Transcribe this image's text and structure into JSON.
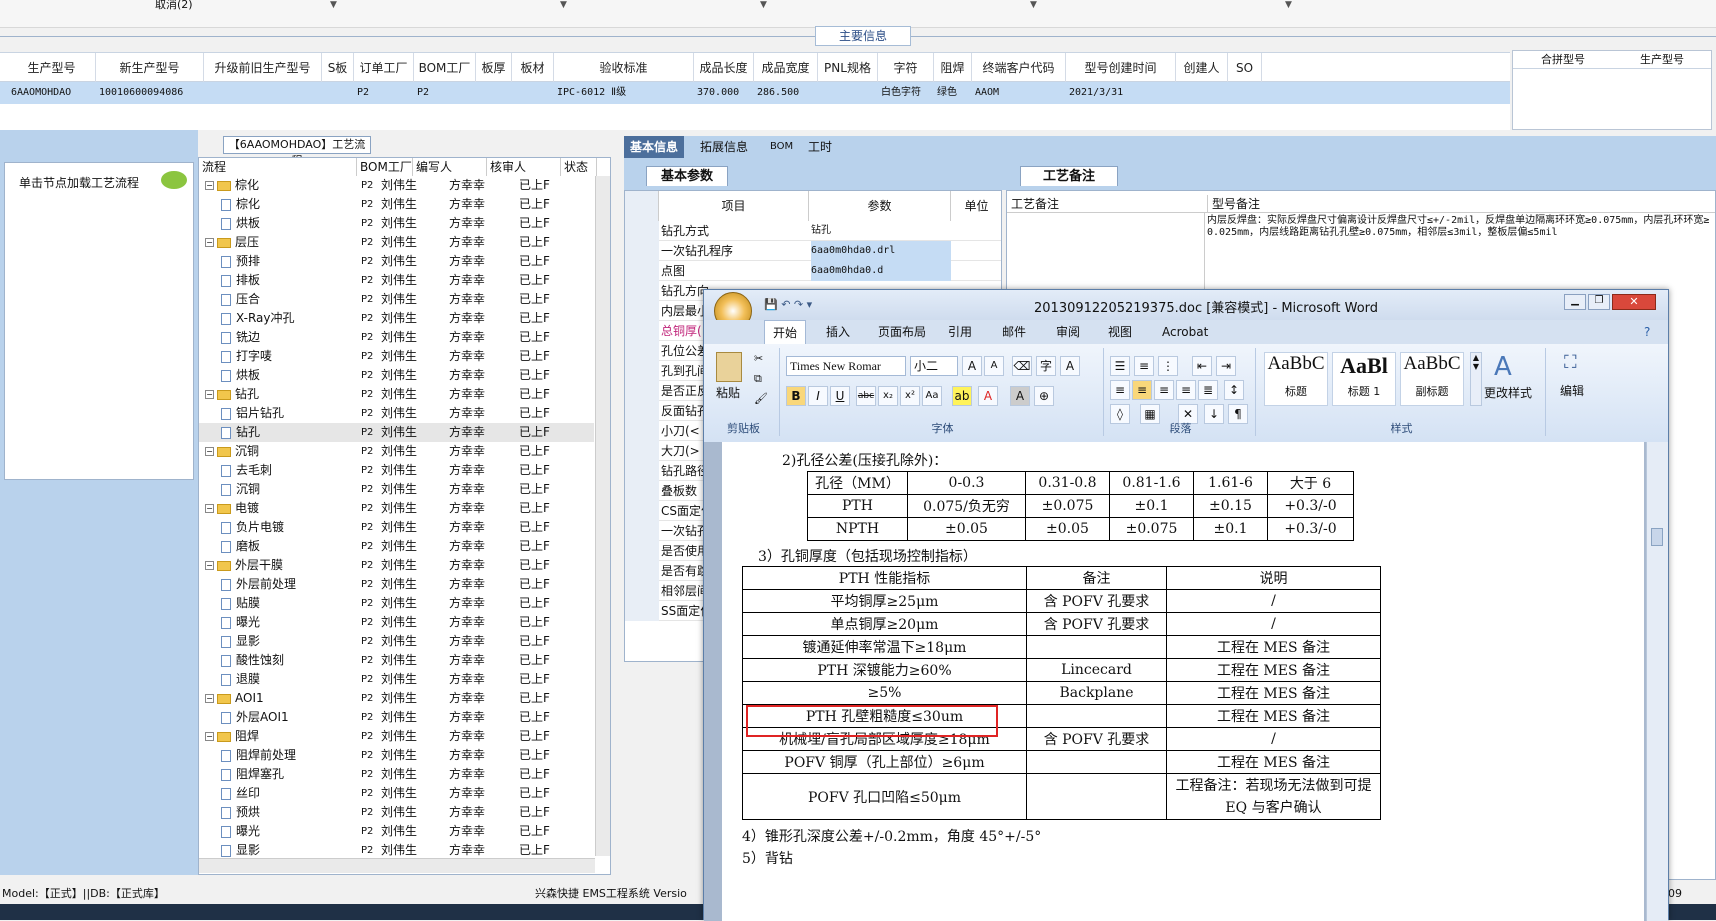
{
  "top": {
    "cancel_label": "取消(2)",
    "main_info_label": "主要信息"
  },
  "info_table": {
    "headers": [
      "生产型号",
      "新生产型号",
      "升级前旧生产型号",
      "S板",
      "订单工厂",
      "BOM工厂",
      "板厚",
      "板材",
      "验收标准",
      "成品长度",
      "成品宽度",
      "PNL规格",
      "字符",
      "阻焊",
      "终端客户代码",
      "型号创建时间",
      "创建人",
      "SO"
    ],
    "row": [
      "6AAOMOHDAO",
      "10010600094086",
      "",
      "",
      "P2",
      "P2",
      "",
      "",
      "IPC-6012 Ⅱ级",
      "370.000",
      "286.500",
      "",
      "白色字符",
      "绿色",
      "AAOM",
      "2021/3/31",
      "",
      ""
    ],
    "right_headers": [
      "合拼型号",
      "生产型号"
    ]
  },
  "left_panel": {
    "title": "单击节点加载工艺流程"
  },
  "process": {
    "title": "【6AAOMOHDAO】工艺流程",
    "headers": [
      "流程",
      "BOM工厂",
      "编写人",
      "核审人",
      "状态"
    ],
    "rows": [
      {
        "name": "棕化",
        "type": "group",
        "factory": "P2",
        "writer": "刘伟生",
        "reviewer": "方幸幸",
        "status": "已上F"
      },
      {
        "name": "棕化",
        "type": "item",
        "factory": "P2",
        "writer": "刘伟生",
        "reviewer": "方幸幸",
        "status": "已上F"
      },
      {
        "name": "烘板",
        "type": "item",
        "factory": "P2",
        "writer": "刘伟生",
        "reviewer": "方幸幸",
        "status": "已上F"
      },
      {
        "name": "层压",
        "type": "group",
        "factory": "P2",
        "writer": "刘伟生",
        "reviewer": "方幸幸",
        "status": "已上F"
      },
      {
        "name": "预排",
        "type": "item",
        "factory": "P2",
        "writer": "刘伟生",
        "reviewer": "方幸幸",
        "status": "已上F"
      },
      {
        "name": "排板",
        "type": "item",
        "factory": "P2",
        "writer": "刘伟生",
        "reviewer": "方幸幸",
        "status": "已上F"
      },
      {
        "name": "压合",
        "type": "item",
        "factory": "P2",
        "writer": "刘伟生",
        "reviewer": "方幸幸",
        "status": "已上F"
      },
      {
        "name": "X-Ray冲孔",
        "type": "item",
        "factory": "P2",
        "writer": "刘伟生",
        "reviewer": "方幸幸",
        "status": "已上F"
      },
      {
        "name": "铣边",
        "type": "item",
        "factory": "P2",
        "writer": "刘伟生",
        "reviewer": "方幸幸",
        "status": "已上F"
      },
      {
        "name": "打字唛",
        "type": "item",
        "factory": "P2",
        "writer": "刘伟生",
        "reviewer": "方幸幸",
        "status": "已上F"
      },
      {
        "name": "烘板",
        "type": "item",
        "factory": "P2",
        "writer": "刘伟生",
        "reviewer": "方幸幸",
        "status": "已上F"
      },
      {
        "name": "钻孔",
        "type": "group",
        "factory": "P2",
        "writer": "刘伟生",
        "reviewer": "方幸幸",
        "status": "已上F"
      },
      {
        "name": "铝片钻孔",
        "type": "item",
        "factory": "P2",
        "writer": "刘伟生",
        "reviewer": "方幸幸",
        "status": "已上F"
      },
      {
        "name": "钻孔",
        "type": "item",
        "factory": "P2",
        "writer": "刘伟生",
        "reviewer": "方幸幸",
        "status": "已上F",
        "selected": true
      },
      {
        "name": "沉铜",
        "type": "group",
        "factory": "P2",
        "writer": "刘伟生",
        "reviewer": "方幸幸",
        "status": "已上F"
      },
      {
        "name": "去毛刺",
        "type": "item",
        "factory": "P2",
        "writer": "刘伟生",
        "reviewer": "方幸幸",
        "status": "已上F"
      },
      {
        "name": "沉铜",
        "type": "item",
        "factory": "P2",
        "writer": "刘伟生",
        "reviewer": "方幸幸",
        "status": "已上F"
      },
      {
        "name": "电镀",
        "type": "group",
        "factory": "P2",
        "writer": "刘伟生",
        "reviewer": "方幸幸",
        "status": "已上F"
      },
      {
        "name": "负片电镀",
        "type": "item",
        "factory": "P2",
        "writer": "刘伟生",
        "reviewer": "方幸幸",
        "status": "已上F"
      },
      {
        "name": "磨板",
        "type": "item",
        "factory": "P2",
        "writer": "刘伟生",
        "reviewer": "方幸幸",
        "status": "已上F"
      },
      {
        "name": "外层干膜",
        "type": "group",
        "factory": "P2",
        "writer": "刘伟生",
        "reviewer": "方幸幸",
        "status": "已上F"
      },
      {
        "name": "外层前处理",
        "type": "item",
        "factory": "P2",
        "writer": "刘伟生",
        "reviewer": "方幸幸",
        "status": "已上F"
      },
      {
        "name": "贴膜",
        "type": "item",
        "factory": "P2",
        "writer": "刘伟生",
        "reviewer": "方幸幸",
        "status": "已上F"
      },
      {
        "name": "曝光",
        "type": "item",
        "factory": "P2",
        "writer": "刘伟生",
        "reviewer": "方幸幸",
        "status": "已上F"
      },
      {
        "name": "显影",
        "type": "item",
        "factory": "P2",
        "writer": "刘伟生",
        "reviewer": "方幸幸",
        "status": "已上F"
      },
      {
        "name": "酸性蚀刻",
        "type": "item",
        "factory": "P2",
        "writer": "刘伟生",
        "reviewer": "方幸幸",
        "status": "已上F"
      },
      {
        "name": "退膜",
        "type": "item",
        "factory": "P2",
        "writer": "刘伟生",
        "reviewer": "方幸幸",
        "status": "已上F"
      },
      {
        "name": "AOI1",
        "type": "group",
        "factory": "P2",
        "writer": "刘伟生",
        "reviewer": "方幸幸",
        "status": "已上F"
      },
      {
        "name": "外层AOI1",
        "type": "item",
        "factory": "P2",
        "writer": "刘伟生",
        "reviewer": "方幸幸",
        "status": "已上F"
      },
      {
        "name": "阻焊",
        "type": "group",
        "factory": "P2",
        "writer": "刘伟生",
        "reviewer": "方幸幸",
        "status": "已上F"
      },
      {
        "name": "阻焊前处理",
        "type": "item",
        "factory": "P2",
        "writer": "刘伟生",
        "reviewer": "方幸幸",
        "status": "已上F"
      },
      {
        "name": "阻焊塞孔",
        "type": "item",
        "factory": "P2",
        "writer": "刘伟生",
        "reviewer": "方幸幸",
        "status": "已上F"
      },
      {
        "name": "丝印",
        "type": "item",
        "factory": "P2",
        "writer": "刘伟生",
        "reviewer": "方幸幸",
        "status": "已上F"
      },
      {
        "name": "预烘",
        "type": "item",
        "factory": "P2",
        "writer": "刘伟生",
        "reviewer": "方幸幸",
        "status": "已上F"
      },
      {
        "name": "曝光",
        "type": "item",
        "factory": "P2",
        "writer": "刘伟生",
        "reviewer": "方幸幸",
        "status": "已上F"
      },
      {
        "name": "显影",
        "type": "item",
        "factory": "P2",
        "writer": "刘伟生",
        "reviewer": "方幸幸",
        "status": "已上F"
      }
    ]
  },
  "main_tabs": [
    "基本信息",
    "拓展信息",
    "BOM",
    "工时"
  ],
  "basic_params": {
    "title": "基本参数",
    "headers": [
      "项目",
      "参数",
      "单位"
    ],
    "rows": [
      [
        "钻孔方式",
        "钻孔"
      ],
      [
        "一次钻孔程序",
        "6aa0m0hda0.drl"
      ],
      [
        "点图",
        "6aa0m0hda0.d"
      ],
      [
        "钻孔方向",
        ""
      ],
      [
        "内层最小",
        ""
      ],
      [
        "总铜厚(",
        ""
      ],
      [
        "孔位公差",
        ""
      ],
      [
        "孔到孔间",
        ""
      ],
      [
        "是否正反",
        ""
      ],
      [
        "反面钻孔",
        ""
      ],
      [
        "小刀(<",
        ""
      ],
      [
        "大刀(>",
        ""
      ],
      [
        "钻孔路径",
        ""
      ],
      [
        "叠板数",
        ""
      ],
      [
        "CS面定位",
        ""
      ],
      [
        "一次钻孔",
        ""
      ],
      [
        "是否使用",
        ""
      ],
      [
        "是否有跳",
        ""
      ],
      [
        "相邻层间",
        ""
      ],
      [
        "SS面定位",
        ""
      ]
    ]
  },
  "remark": {
    "tab": "工艺备注",
    "col1": "工艺备注",
    "col2": "型号备注",
    "text": "内层反焊盘：实际反焊盘尺寸偏离设计反焊盘尺寸≤+/-2mil，反焊盘单边隔离环环宽≥0.075mm，内层孔环环宽≥0.025mm，内层线路距离钻孔孔壁≥0.075mm，相邻层≤3mil，整板层偏≤5mil"
  },
  "status": {
    "left": "Model:【正式】||DB:【正式库】",
    "right": "兴森快捷 EMS工程系统 Versio",
    "num": "09"
  },
  "word": {
    "title": "20130912205219375.doc [兼容模式] - Microsoft Word",
    "tabs": [
      "开始",
      "插入",
      "页面布局",
      "引用",
      "邮件",
      "审阅",
      "视图",
      "Acrobat"
    ],
    "font_name": "Times New Romar",
    "font_size": "小二",
    "groups": {
      "clipboard": "剪贴板",
      "font": "字体",
      "paragraph": "段落",
      "styles": "样式",
      "paste": "粘贴",
      "change_styles": "更改样式",
      "edit": "编辑"
    },
    "styles": [
      {
        "sample": "AaBbC",
        "name": "标题"
      },
      {
        "sample": "AaBl",
        "name": "标题 1"
      },
      {
        "sample": "AaBbC",
        "name": "副标题"
      }
    ],
    "doc": {
      "line_top": "2)孔径公差(压接孔除外)：",
      "t1": [
        [
          "孔径（MM）",
          "0-0.3",
          "0.31-0.8",
          "0.81-1.6",
          "1.61-6",
          "大于 6"
        ],
        [
          "PTH",
          "0.075/负无穷",
          "±0.075",
          "±0.1",
          "±0.15",
          "+0.3/-0"
        ],
        [
          "NPTH",
          "±0.05",
          "±0.05",
          "±0.075",
          "±0.1",
          "+0.3/-0"
        ]
      ],
      "line2": "3）孔铜厚度（包括现场控制指标）",
      "t2": [
        [
          "PTH 性能指标",
          "备注",
          "说明"
        ],
        [
          "平均铜厚≥25μm",
          "含 POFV 孔要求",
          "/"
        ],
        [
          "单点铜厚≥20μm",
          "含 POFV 孔要求",
          "/"
        ],
        [
          "镀通延伸率常温下≥18μm",
          "",
          "工程在 MES 备注"
        ],
        [
          "PTH 深镀能力≥60%",
          "Lincecard",
          "工程在 MES 备注"
        ],
        [
          "≥5%",
          "Backplane",
          "工程在 MES 备注"
        ],
        [
          "PTH 孔壁粗糙度≤30um",
          "",
          "工程在 MES 备注"
        ],
        [
          "机械埋/盲孔局部区域厚度≥18μm",
          "含 POFV 孔要求",
          "/"
        ],
        [
          "POFV 铜厚（孔上部位）≥6μm",
          "",
          "工程在 MES 备注"
        ],
        [
          "POFV 孔口凹陷≤50μm",
          "",
          "工程备注：若现场无法做到可提 EQ 与客户确认"
        ]
      ],
      "line3": "4）锥形孔深度公差+/-0.2mm，角度 45°+/-5°",
      "line4": "5）背钻"
    }
  }
}
